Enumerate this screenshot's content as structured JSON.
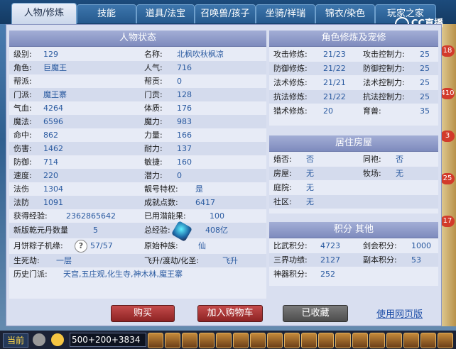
{
  "tabs": [
    "人物/修炼",
    "技能",
    "道具/法宝",
    "召唤兽/孩子",
    "坐骑/祥瑞",
    "锦衣/染色",
    "玩家之家"
  ],
  "brand": "CC直播",
  "right_badges": [
    "18",
    "410",
    "3",
    "25",
    "17"
  ],
  "status": {
    "title": "人物状态",
    "left": [
      {
        "label": "级别:",
        "value": "129"
      },
      {
        "label": "角色:",
        "value": "巨魔王"
      },
      {
        "label": "帮派:",
        "value": ""
      },
      {
        "label": "门派:",
        "value": "魔王寨"
      },
      {
        "label": "气血:",
        "value": "4264"
      },
      {
        "label": "魔法:",
        "value": "6596"
      },
      {
        "label": "命中:",
        "value": "862"
      },
      {
        "label": "伤害:",
        "value": "1462"
      },
      {
        "label": "防御:",
        "value": "714"
      },
      {
        "label": "速度:",
        "value": "220"
      },
      {
        "label": "法伤",
        "value": "1304"
      },
      {
        "label": "法防",
        "value": "1091"
      }
    ],
    "right": [
      {
        "label": "名称:",
        "value": "北枫吹秋枫凉"
      },
      {
        "label": "人气:",
        "value": "716"
      },
      {
        "label": "帮贡:",
        "value": "0"
      },
      {
        "label": "门贡:",
        "value": "128"
      },
      {
        "label": "体质:",
        "value": "176"
      },
      {
        "label": "魔力:",
        "value": "983"
      },
      {
        "label": "力量:",
        "value": "166"
      },
      {
        "label": "耐力:",
        "value": "137"
      },
      {
        "label": "敏捷:",
        "value": "160"
      },
      {
        "label": "潜力:",
        "value": "0"
      },
      {
        "label": "靓号特权:",
        "value": "是"
      },
      {
        "label": "成就点数:",
        "value": "6417"
      }
    ],
    "exp_label": "获得经验:",
    "exp_value": "2362865642",
    "used_label": "已用潜能果:",
    "used_value": "100",
    "qianyuan_label": "新版乾元丹数量",
    "qianyuan_value": "5",
    "total_exp_label": "总经验:",
    "total_exp_value": "408亿",
    "yuebing_label": "月饼粽子机缘:",
    "yuebing_value": "57/57",
    "origin_label": "原始种族:",
    "origin_value": "仙",
    "shengsi_label": "生死劫:",
    "shengsi_value": "一层",
    "feisheng_label": "飞升/渡劫/化圣:",
    "feisheng_value": "飞升",
    "history_label": "历史门派:",
    "history_value": "天宫,五庄观,化生寺,神木林,魔王寨"
  },
  "cultivation": {
    "title": "角色修炼及宠修",
    "left": [
      {
        "label": "攻击修炼:",
        "value": "21/23"
      },
      {
        "label": "防御修炼:",
        "value": "21/22"
      },
      {
        "label": "法术修炼:",
        "value": "21/21"
      },
      {
        "label": "抗法修炼:",
        "value": "21/22"
      },
      {
        "label": "猎术修炼:",
        "value": "20"
      }
    ],
    "right": [
      {
        "label": "攻击控制力:",
        "value": "25"
      },
      {
        "label": "防御控制力:",
        "value": "25"
      },
      {
        "label": "法术控制力:",
        "value": "25"
      },
      {
        "label": "抗法控制力:",
        "value": "25"
      },
      {
        "label": "育兽:",
        "value": "35"
      }
    ]
  },
  "housing": {
    "title": "居住房屋",
    "rows": [
      {
        "l1": "婚否:",
        "v1": "否",
        "l2": "同袍:",
        "v2": "否"
      },
      {
        "l1": "房屋:",
        "v1": "无",
        "l2": "牧场:",
        "v2": "无"
      },
      {
        "l1": "庭院:",
        "v1": "无",
        "l2": "",
        "v2": ""
      },
      {
        "l1": "社区:",
        "v1": "无",
        "l2": "",
        "v2": ""
      }
    ]
  },
  "points": {
    "title": "积分 其他",
    "rows": [
      {
        "l1": "比武积分:",
        "v1": "4723",
        "l2": "剑会积分:",
        "v2": "1000"
      },
      {
        "l1": "三界功绩:",
        "v1": "2127",
        "l2": "副本积分:",
        "v2": "53"
      },
      {
        "l1": "神器积分:",
        "v1": "252",
        "l2": "",
        "v2": ""
      }
    ]
  },
  "buttons": {
    "buy": "购买",
    "cart": "加入购物车",
    "collected": "已收藏",
    "web": "使用网页版"
  },
  "taskbar": {
    "now": "当前",
    "input": "500+200+3834"
  },
  "colors": {
    "accent": "#2a5aa0",
    "header": "#8e9acb",
    "button_red": "#a83333"
  }
}
